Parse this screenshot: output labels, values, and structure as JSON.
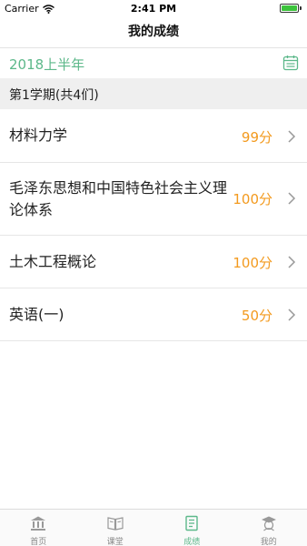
{
  "status_bar": {
    "carrier": "Carrier",
    "time": "2:41 PM",
    "wifi_icon": "wifi-icon",
    "battery_icon": "battery-icon"
  },
  "nav": {
    "title": "我的成绩"
  },
  "term": {
    "label": "2018上半年",
    "icon": "calendar-icon",
    "color": "#5cb88a"
  },
  "section": {
    "label": "第1学期(共4们)"
  },
  "courses": [
    {
      "name": "材料力学",
      "score": "99分"
    },
    {
      "name": "毛泽东思想和中国特色社会主义理论体系",
      "score": "100分"
    },
    {
      "name": "土木工程概论",
      "score": "100分"
    },
    {
      "name": "英语(一)",
      "score": "50分"
    }
  ],
  "score_color": "#f39a1e",
  "tabs": [
    {
      "label": "首页",
      "icon": "bank-icon"
    },
    {
      "label": "课堂",
      "icon": "book-icon"
    },
    {
      "label": "成绩",
      "icon": "report-icon",
      "active": true
    },
    {
      "label": "我的",
      "icon": "graduate-icon"
    }
  ]
}
